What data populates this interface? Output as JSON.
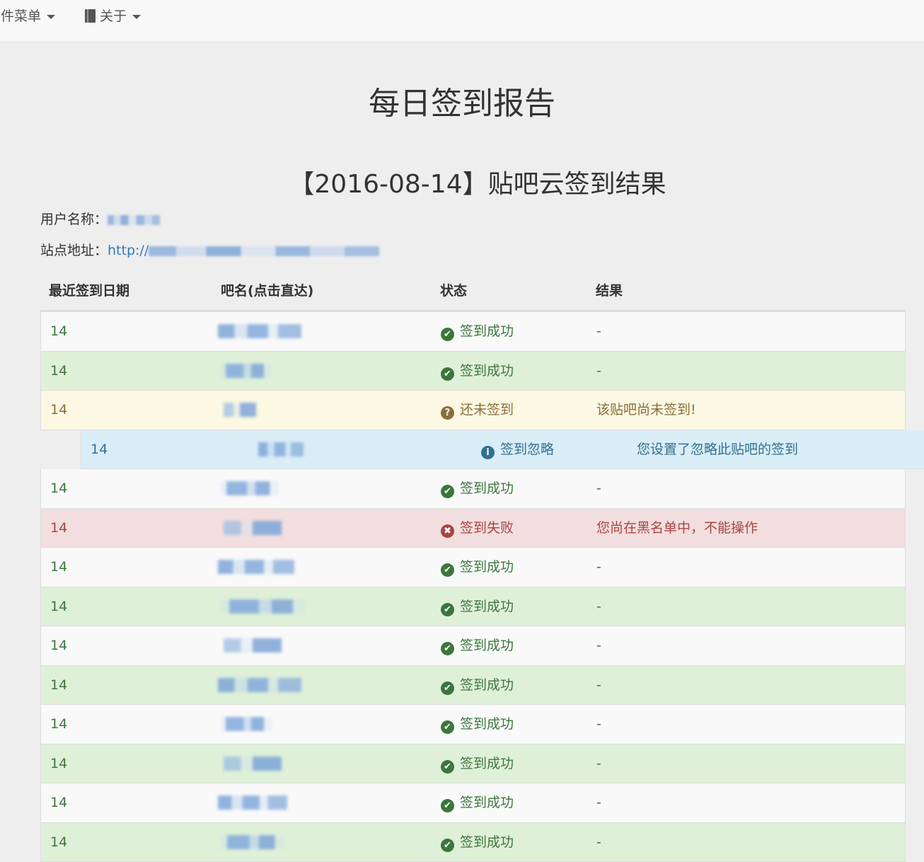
{
  "nav": {
    "menu_label": "插件菜单",
    "about_label": "关于"
  },
  "page": {
    "title": "每日签到报告",
    "subtitle": "【2016-08-14】贴吧云签到结果"
  },
  "info": {
    "user_label": "用户名称：",
    "site_label": "站点地址：",
    "site_url_prefix": "http://"
  },
  "table": {
    "headers": [
      "最近签到日期",
      "吧名(点击直达)",
      "状态",
      "结果"
    ],
    "rows": [
      {
        "date": "14",
        "status": "签到成功",
        "result": "-",
        "type": "success"
      },
      {
        "date": "14",
        "status": "签到成功",
        "result": "-",
        "type": "success"
      },
      {
        "date": "14",
        "status": "还未签到",
        "result": "该贴吧尚未签到!",
        "type": "warning"
      },
      {
        "date": "14",
        "status": "签到忽略",
        "result": "您设置了忽略此贴吧的签到",
        "type": "info"
      },
      {
        "date": "14",
        "status": "签到成功",
        "result": "-",
        "type": "success"
      },
      {
        "date": "14",
        "status": "签到失败",
        "result": "您尚在黑名单中，不能操作",
        "type": "danger"
      },
      {
        "date": "14",
        "status": "签到成功",
        "result": "-",
        "type": "success"
      },
      {
        "date": "14",
        "status": "签到成功",
        "result": "-",
        "type": "success"
      },
      {
        "date": "14",
        "status": "签到成功",
        "result": "-",
        "type": "success"
      },
      {
        "date": "14",
        "status": "签到成功",
        "result": "-",
        "type": "success"
      },
      {
        "date": "14",
        "status": "签到成功",
        "result": "-",
        "type": "success"
      },
      {
        "date": "14",
        "status": "签到成功",
        "result": "-",
        "type": "success"
      },
      {
        "date": "14",
        "status": "签到成功",
        "result": "-",
        "type": "success"
      },
      {
        "date": "14",
        "status": "签到成功",
        "result": "-",
        "type": "success"
      }
    ]
  },
  "icons": {
    "success": "check-circle-icon",
    "warning": "question-circle-icon",
    "info": "info-circle-icon",
    "danger": "times-circle-icon"
  },
  "colors": {
    "success_icon": "#3c763d",
    "warning_icon": "#8a6d3b",
    "info_icon": "#31708f",
    "danger_icon": "#a94442",
    "link": "#337ab7"
  }
}
